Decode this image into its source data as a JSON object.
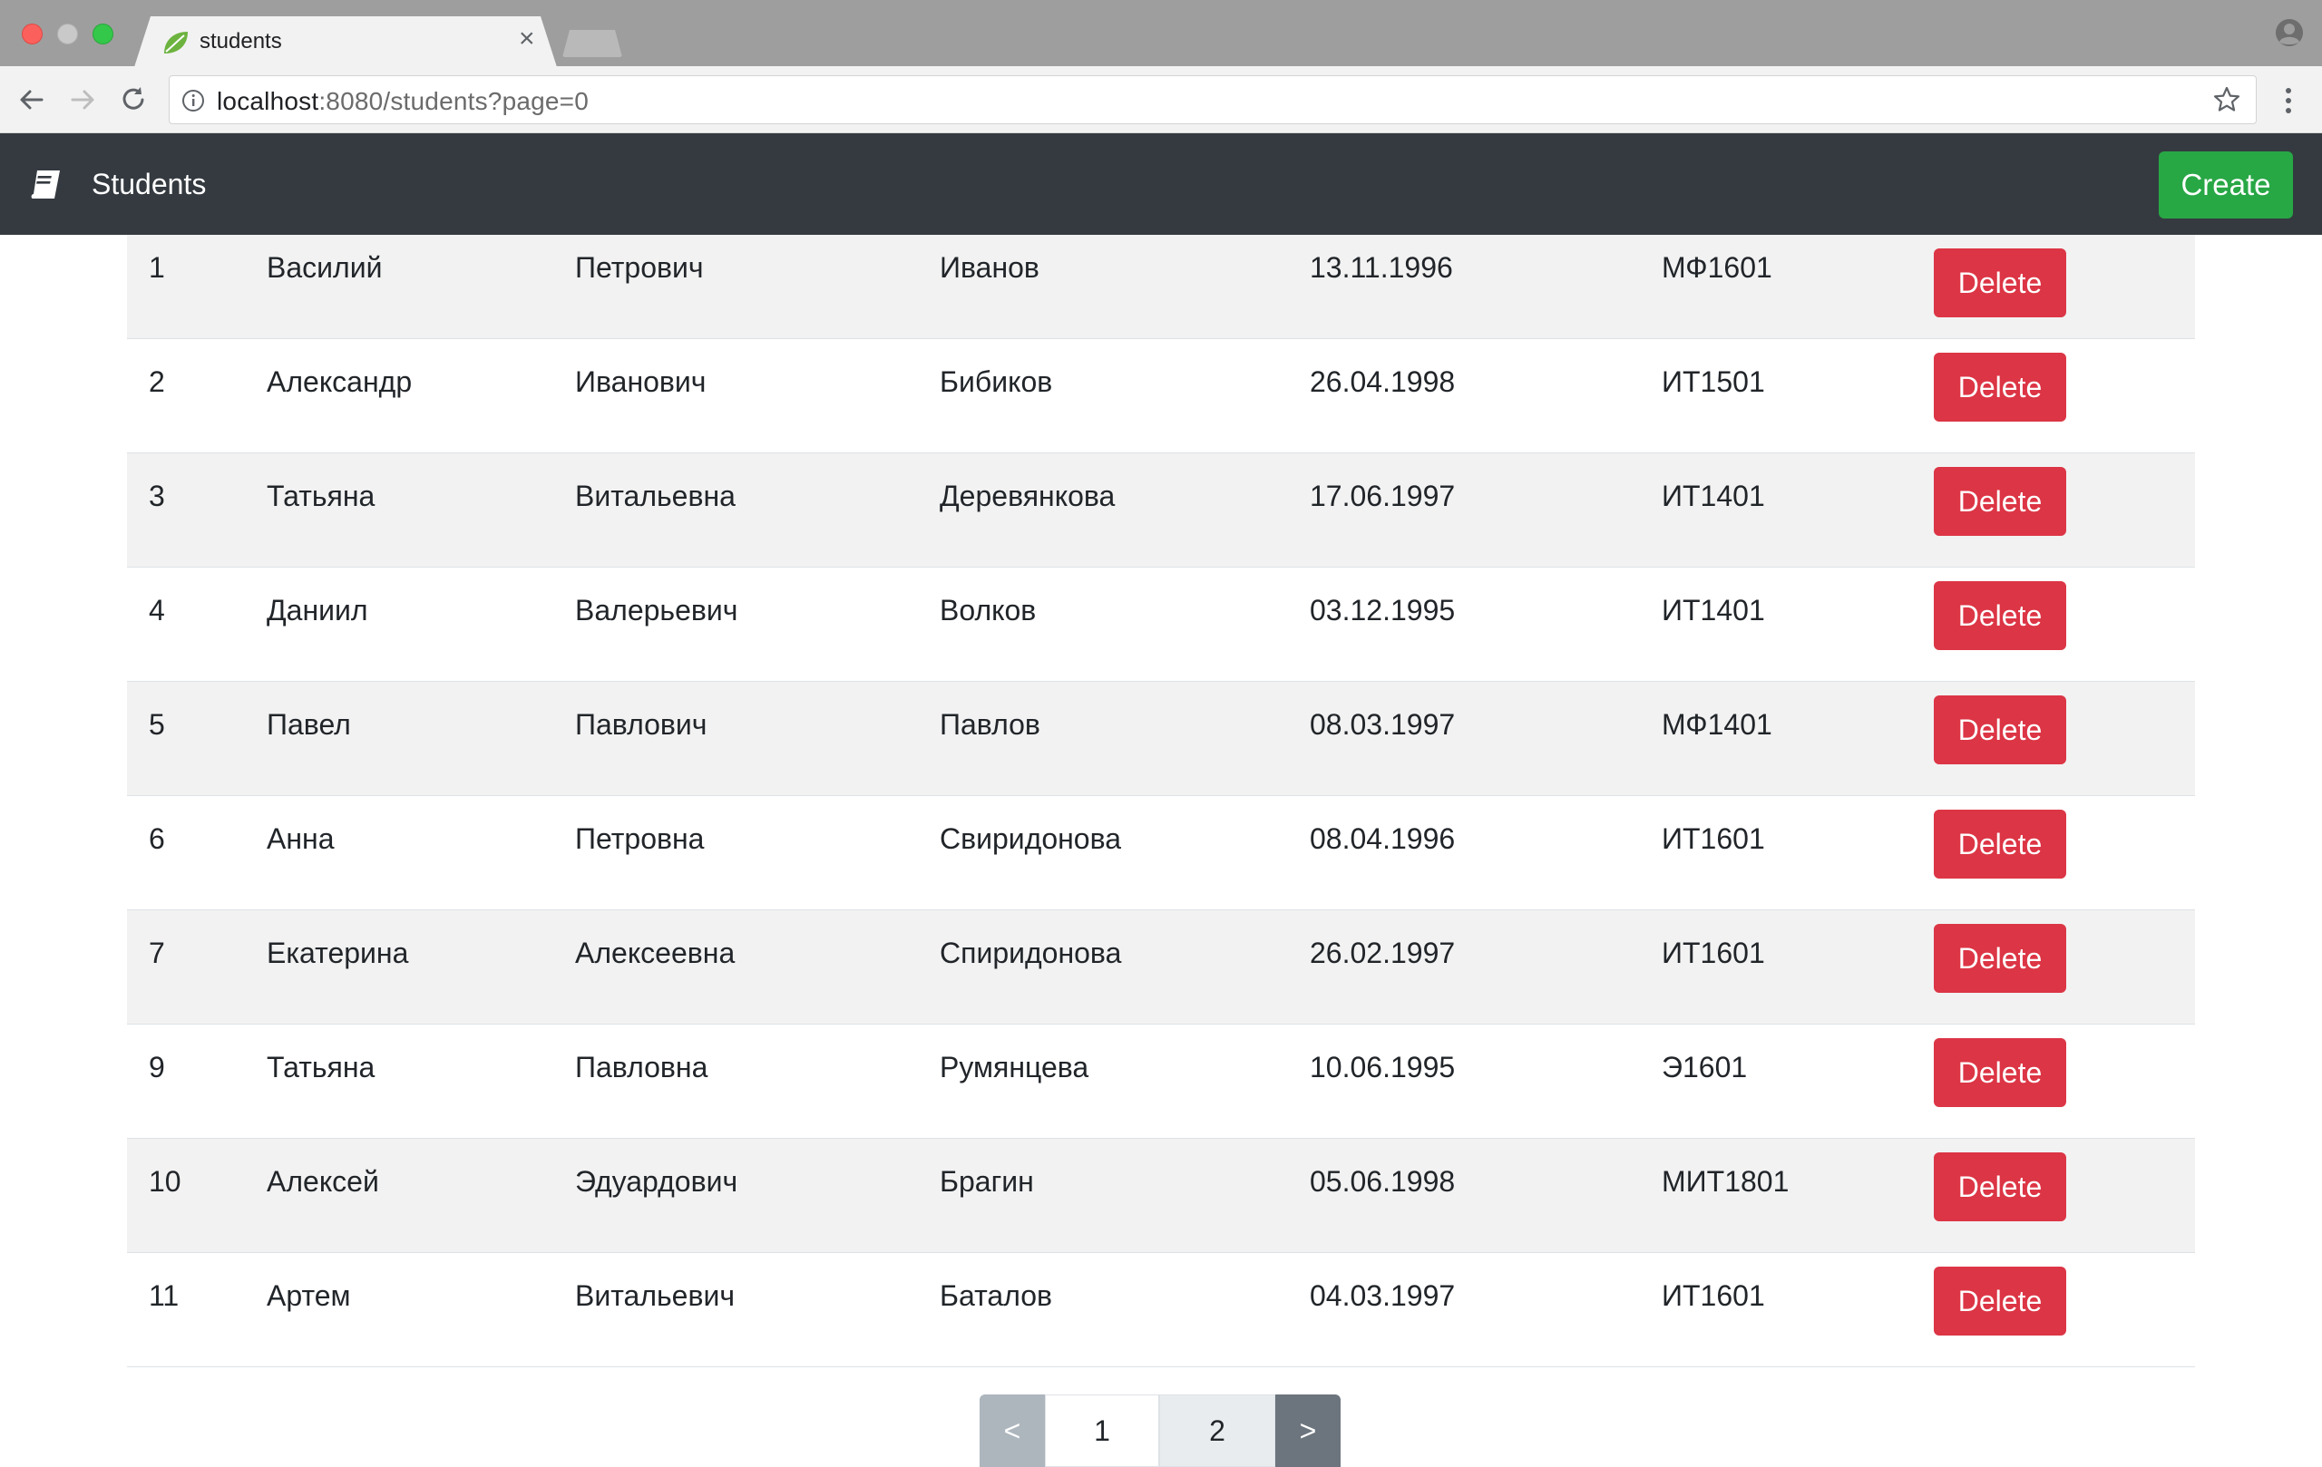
{
  "browser": {
    "tab_title": "students",
    "url_host": "localhost",
    "url_rest": ":8080/students?page=0"
  },
  "navbar": {
    "brand_icon": "book-icon",
    "brand": "Students",
    "create_label": "Create"
  },
  "colors": {
    "navbar": "#343a40",
    "create": "#28a745",
    "delete": "#dc3545",
    "stripe": "#f2f2f2"
  },
  "students": [
    {
      "id": "1",
      "first": "Василий",
      "middle": "Петрович",
      "last": "Иванов",
      "birth": "13.11.1996",
      "group": "МФ1601",
      "action": "Delete"
    },
    {
      "id": "2",
      "first": "Александр",
      "middle": "Иванович",
      "last": "Бибиков",
      "birth": "26.04.1998",
      "group": "ИТ1501",
      "action": "Delete"
    },
    {
      "id": "3",
      "first": "Татьяна",
      "middle": "Витальевна",
      "last": "Деревянкова",
      "birth": "17.06.1997",
      "group": "ИТ1401",
      "action": "Delete"
    },
    {
      "id": "4",
      "first": "Даниил",
      "middle": "Валерьевич",
      "last": "Волков",
      "birth": "03.12.1995",
      "group": "ИТ1401",
      "action": "Delete"
    },
    {
      "id": "5",
      "first": "Павел",
      "middle": "Павлович",
      "last": "Павлов",
      "birth": "08.03.1997",
      "group": "МФ1401",
      "action": "Delete"
    },
    {
      "id": "6",
      "first": "Анна",
      "middle": "Петровна",
      "last": "Свиридонова",
      "birth": "08.04.1996",
      "group": "ИТ1601",
      "action": "Delete"
    },
    {
      "id": "7",
      "first": "Екатерина",
      "middle": "Алексеевна",
      "last": "Спиридонова",
      "birth": "26.02.1997",
      "group": "ИТ1601",
      "action": "Delete"
    },
    {
      "id": "9",
      "first": "Татьяна",
      "middle": "Павловна",
      "last": "Румянцева",
      "birth": "10.06.1995",
      "group": "Э1601",
      "action": "Delete"
    },
    {
      "id": "10",
      "first": "Алексей",
      "middle": "Эдуардович",
      "last": "Брагин",
      "birth": "05.06.1998",
      "group": "МИТ1801",
      "action": "Delete"
    },
    {
      "id": "11",
      "first": "Артем",
      "middle": "Витальевич",
      "last": "Баталов",
      "birth": "04.03.1997",
      "group": "ИТ1601",
      "action": "Delete"
    }
  ],
  "pagination": {
    "prev": "<",
    "pages": [
      "1",
      "2"
    ],
    "next": ">"
  }
}
